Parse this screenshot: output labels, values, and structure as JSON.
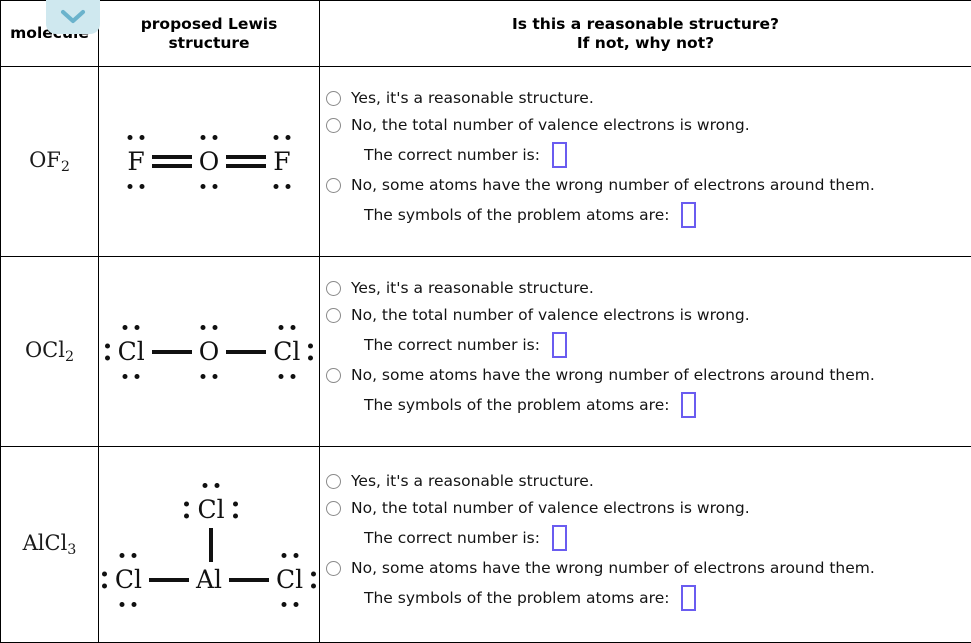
{
  "header": {
    "col_molecule": "molecule",
    "col_structure": "proposed Lewis\nstructure",
    "col_structure_line1": "proposed Lewis",
    "col_structure_line2": "structure",
    "col_question_line1": "Is this a reasonable structure?",
    "col_question_line2": "If not, why not?"
  },
  "dropdown": {
    "icon": "chevron-down-icon",
    "background_color": "#cfe8ef",
    "icon_color": "#6bb3cc"
  },
  "colors": {
    "answer_box_border": "#6a5cf0",
    "radio_border": "#8a8a8a",
    "table_border": "#000000",
    "text": "#141414"
  },
  "options": {
    "yes": "Yes, it's a reasonable structure.",
    "no_valence": "No, the total number of valence electrons is wrong.",
    "correct_number_label": "The correct number is:",
    "no_atoms": "No, some atoms have the wrong number of electrons around them.",
    "problem_atoms_label": "The symbols of the problem atoms are:"
  },
  "rows": [
    {
      "molecule_formula": "OF2",
      "molecule_base": "OF",
      "molecule_sub": "2",
      "structure": {
        "layout": "linear",
        "atoms": [
          "F",
          "O",
          "F"
        ],
        "bonds": [
          "double",
          "double"
        ],
        "lone_pairs": [
          {
            "atom": "F",
            "positions": [
              "top",
              "bottom"
            ]
          },
          {
            "atom": "O",
            "positions": [
              "top",
              "bottom"
            ]
          },
          {
            "atom": "F",
            "positions": [
              "top",
              "bottom"
            ]
          }
        ]
      },
      "correct_number_value": "",
      "problem_atoms_value": "",
      "selected_option": null
    },
    {
      "molecule_formula": "OCl2",
      "molecule_base": "OCl",
      "molecule_sub": "2",
      "structure": {
        "layout": "linear",
        "atoms": [
          "Cl",
          "O",
          "Cl"
        ],
        "bonds": [
          "single",
          "single"
        ],
        "lone_pairs": [
          {
            "atom": "Cl",
            "positions": [
              "top",
              "bottom",
              "left"
            ]
          },
          {
            "atom": "O",
            "positions": [
              "top",
              "bottom"
            ]
          },
          {
            "atom": "Cl",
            "positions": [
              "top",
              "bottom",
              "right"
            ]
          }
        ]
      },
      "correct_number_value": "",
      "problem_atoms_value": "",
      "selected_option": null
    },
    {
      "molecule_formula": "AlCl3",
      "molecule_base": "AlCl",
      "molecule_sub": "3",
      "structure": {
        "layout": "trigonal",
        "center_atom": "Al",
        "atoms": [
          "Cl",
          "Cl",
          "Al",
          "Cl"
        ],
        "bonds": [
          "vertical-single",
          "single",
          "single"
        ],
        "lone_pairs": [
          {
            "atom": "Cl-top",
            "positions": [
              "top",
              "left",
              "right"
            ]
          },
          {
            "atom": "Cl-left",
            "positions": [
              "top",
              "bottom",
              "left"
            ]
          },
          {
            "atom": "Al",
            "positions": []
          },
          {
            "atom": "Cl-right",
            "positions": [
              "top",
              "bottom",
              "right"
            ]
          }
        ]
      },
      "correct_number_value": "",
      "problem_atoms_value": "",
      "selected_option": null
    }
  ]
}
